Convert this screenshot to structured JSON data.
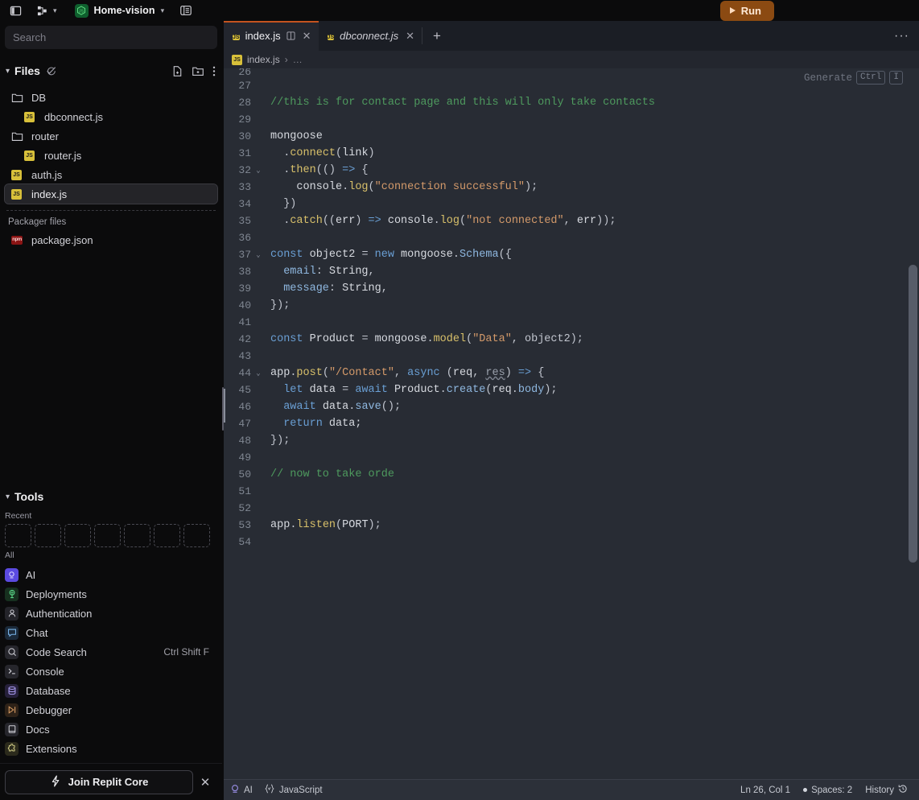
{
  "topbar": {
    "panel_toggle_icon": "sidebar-toggle-icon",
    "layout_icon": "layout-grid-icon",
    "project_name": "Home-vision",
    "project_icon": "nodejs-icon",
    "list_icon": "database-list-icon",
    "run_label": "Run",
    "run_color": "#8b4a12"
  },
  "sidebar": {
    "search": {
      "placeholder": "Search",
      "value": ""
    },
    "files": {
      "title": "Files",
      "caret": "⌄",
      "new_file_icon": "new-file-icon",
      "new_folder_icon": "new-folder-icon",
      "more_icon": "kebab-menu-icon",
      "tree": [
        {
          "label": "DB",
          "type": "folder",
          "indent": 0,
          "selected": false
        },
        {
          "label": "dbconnect.js",
          "type": "js",
          "indent": 1,
          "selected": false
        },
        {
          "label": "router",
          "type": "folder",
          "indent": 0,
          "selected": false
        },
        {
          "label": "router.js",
          "type": "js",
          "indent": 1,
          "selected": false
        },
        {
          "label": "auth.js",
          "type": "js",
          "indent": 0,
          "selected": false
        },
        {
          "label": "index.js",
          "type": "js",
          "indent": 0,
          "selected": true
        }
      ],
      "packager_label": "Packager files",
      "packager_files": [
        {
          "label": "package.json",
          "type": "json"
        }
      ]
    },
    "tools": {
      "title": "Tools",
      "recent_label": "Recent",
      "recent_slots": 7,
      "all_label": "All",
      "items": [
        {
          "label": "AI",
          "icon": "ai-icon",
          "color": "#5b4ae0",
          "shortcut": ""
        },
        {
          "label": "Deployments",
          "icon": "deployments-icon",
          "color": "#17301f",
          "shortcut": ""
        },
        {
          "label": "Authentication",
          "icon": "authentication-icon",
          "color": "#24242a",
          "shortcut": ""
        },
        {
          "label": "Chat",
          "icon": "chat-icon",
          "color": "#1b2a3a",
          "shortcut": ""
        },
        {
          "label": "Code Search",
          "icon": "code-search-icon",
          "color": "#26262c",
          "shortcut": "Ctrl Shift F"
        },
        {
          "label": "Console",
          "icon": "console-icon",
          "color": "#26262c",
          "shortcut": ""
        },
        {
          "label": "Database",
          "icon": "database-icon",
          "color": "#26203a",
          "shortcut": ""
        },
        {
          "label": "Debugger",
          "icon": "debugger-icon",
          "color": "#2e2218",
          "shortcut": ""
        },
        {
          "label": "Docs",
          "icon": "docs-icon",
          "color": "#26262c",
          "shortcut": ""
        },
        {
          "label": "Extensions",
          "icon": "extensions-icon",
          "color": "#2b2a1c",
          "shortcut": ""
        }
      ]
    },
    "core_banner": {
      "label": "Join Replit Core",
      "icon": "bolt-icon",
      "close_icon": "close-icon"
    }
  },
  "editor": {
    "tabs": [
      {
        "label": "index.js",
        "icon": "js-file-icon",
        "active": true,
        "preview": false,
        "split_icon": "split-editor-icon",
        "close_icon": "close-icon"
      },
      {
        "label": "dbconnect.js",
        "icon": "js-file-icon",
        "active": false,
        "preview": true,
        "close_icon": "close-icon"
      }
    ],
    "add_tab_label": "+",
    "more_label": "···",
    "breadcrumb": {
      "file": "index.js",
      "separator": "›",
      "tail": "…"
    },
    "ghost_generate": {
      "label": "Generate",
      "key1": "Ctrl",
      "key2": "I"
    },
    "lines": [
      {
        "n": 26,
        "fold": "",
        "partial": true,
        "tokens": []
      },
      {
        "n": 27,
        "fold": "",
        "tokens": []
      },
      {
        "n": 28,
        "fold": "",
        "tokens": [
          {
            "t": "//this is for contact page and this will only take contacts",
            "c": "cm"
          }
        ]
      },
      {
        "n": 29,
        "fold": "",
        "tokens": []
      },
      {
        "n": 30,
        "fold": "",
        "tokens": [
          {
            "t": "mongoose",
            "c": "vr"
          }
        ]
      },
      {
        "n": 31,
        "fold": "",
        "tokens": [
          {
            "t": "  .",
            "c": "pu"
          },
          {
            "t": "connect",
            "c": "fn"
          },
          {
            "t": "(",
            "c": "pu"
          },
          {
            "t": "link",
            "c": "vr"
          },
          {
            "t": ")",
            "c": "pu"
          }
        ]
      },
      {
        "n": 32,
        "fold": "⌄",
        "tokens": [
          {
            "t": "  .",
            "c": "pu"
          },
          {
            "t": "then",
            "c": "fn"
          },
          {
            "t": "(() ",
            "c": "pu"
          },
          {
            "t": "=>",
            "c": "k"
          },
          {
            "t": " {",
            "c": "pu"
          }
        ]
      },
      {
        "n": 33,
        "fold": "",
        "tokens": [
          {
            "t": "    ",
            "c": "pu"
          },
          {
            "t": "console",
            "c": "vr"
          },
          {
            "t": ".",
            "c": "pu"
          },
          {
            "t": "log",
            "c": "fn"
          },
          {
            "t": "(",
            "c": "pu"
          },
          {
            "t": "\"connection successful\"",
            "c": "st"
          },
          {
            "t": ");",
            "c": "pu"
          }
        ]
      },
      {
        "n": 34,
        "fold": "",
        "tokens": [
          {
            "t": "  })",
            "c": "pu"
          }
        ]
      },
      {
        "n": 35,
        "fold": "",
        "tokens": [
          {
            "t": "  .",
            "c": "pu"
          },
          {
            "t": "catch",
            "c": "fn"
          },
          {
            "t": "((",
            "c": "pu"
          },
          {
            "t": "err",
            "c": "vr"
          },
          {
            "t": ") ",
            "c": "pu"
          },
          {
            "t": "=>",
            "c": "k"
          },
          {
            "t": " ",
            "c": "pu"
          },
          {
            "t": "console",
            "c": "vr"
          },
          {
            "t": ".",
            "c": "pu"
          },
          {
            "t": "log",
            "c": "fn"
          },
          {
            "t": "(",
            "c": "pu"
          },
          {
            "t": "\"not connected\"",
            "c": "st"
          },
          {
            "t": ", ",
            "c": "pu"
          },
          {
            "t": "err",
            "c": "vr"
          },
          {
            "t": "));",
            "c": "pu"
          }
        ]
      },
      {
        "n": 36,
        "fold": "",
        "tokens": []
      },
      {
        "n": 37,
        "fold": "⌄",
        "tokens": [
          {
            "t": "const",
            "c": "k"
          },
          {
            "t": " object2 ",
            "c": "vr"
          },
          {
            "t": "= ",
            "c": "pu"
          },
          {
            "t": "new",
            "c": "k"
          },
          {
            "t": " mongoose",
            "c": "vr"
          },
          {
            "t": ".",
            "c": "pu"
          },
          {
            "t": "Schema",
            "c": "pr"
          },
          {
            "t": "({",
            "c": "pu"
          }
        ]
      },
      {
        "n": 38,
        "fold": "",
        "tokens": [
          {
            "t": "  ",
            "c": "pu"
          },
          {
            "t": "email",
            "c": "pr"
          },
          {
            "t": ": ",
            "c": "pu"
          },
          {
            "t": "String",
            "c": "vr"
          },
          {
            "t": ",",
            "c": "pu"
          }
        ]
      },
      {
        "n": 39,
        "fold": "",
        "tokens": [
          {
            "t": "  ",
            "c": "pu"
          },
          {
            "t": "message",
            "c": "pr"
          },
          {
            "t": ": ",
            "c": "pu"
          },
          {
            "t": "String",
            "c": "vr"
          },
          {
            "t": ",",
            "c": "pu"
          }
        ]
      },
      {
        "n": 40,
        "fold": "",
        "tokens": [
          {
            "t": "});",
            "c": "pu"
          }
        ]
      },
      {
        "n": 41,
        "fold": "",
        "tokens": []
      },
      {
        "n": 42,
        "fold": "",
        "tokens": [
          {
            "t": "const",
            "c": "k"
          },
          {
            "t": " Product ",
            "c": "vr"
          },
          {
            "t": "= ",
            "c": "pu"
          },
          {
            "t": "mongoose",
            "c": "vr"
          },
          {
            "t": ".",
            "c": "pu"
          },
          {
            "t": "model",
            "c": "fn"
          },
          {
            "t": "(",
            "c": "pu"
          },
          {
            "t": "\"Data\"",
            "c": "st"
          },
          {
            "t": ", object2);",
            "c": "pu"
          }
        ]
      },
      {
        "n": 43,
        "fold": "",
        "tokens": []
      },
      {
        "n": 44,
        "fold": "⌄",
        "tokens": [
          {
            "t": "app",
            "c": "vr"
          },
          {
            "t": ".",
            "c": "pu"
          },
          {
            "t": "post",
            "c": "fn"
          },
          {
            "t": "(",
            "c": "pu"
          },
          {
            "t": "\"/Contact\"",
            "c": "st"
          },
          {
            "t": ", ",
            "c": "pu"
          },
          {
            "t": "async",
            "c": "k"
          },
          {
            "t": " (",
            "c": "pu"
          },
          {
            "t": "req",
            "c": "vr"
          },
          {
            "t": ", ",
            "c": "pu"
          },
          {
            "t": "res",
            "c": "un"
          },
          {
            "t": ") ",
            "c": "pu"
          },
          {
            "t": "=>",
            "c": "k"
          },
          {
            "t": " {",
            "c": "pu"
          }
        ]
      },
      {
        "n": 45,
        "fold": "",
        "tokens": [
          {
            "t": "  ",
            "c": "pu"
          },
          {
            "t": "let",
            "c": "k"
          },
          {
            "t": " data ",
            "c": "vr"
          },
          {
            "t": "= ",
            "c": "pu"
          },
          {
            "t": "await",
            "c": "k"
          },
          {
            "t": " Product",
            "c": "vr"
          },
          {
            "t": ".",
            "c": "pu"
          },
          {
            "t": "create",
            "c": "pr"
          },
          {
            "t": "(",
            "c": "pu"
          },
          {
            "t": "req",
            "c": "vr"
          },
          {
            "t": ".",
            "c": "pu"
          },
          {
            "t": "body",
            "c": "pr"
          },
          {
            "t": ");",
            "c": "pu"
          }
        ]
      },
      {
        "n": 46,
        "fold": "",
        "tokens": [
          {
            "t": "  ",
            "c": "pu"
          },
          {
            "t": "await",
            "c": "k"
          },
          {
            "t": " data",
            "c": "vr"
          },
          {
            "t": ".",
            "c": "pu"
          },
          {
            "t": "save",
            "c": "pr"
          },
          {
            "t": "();",
            "c": "pu"
          }
        ]
      },
      {
        "n": 47,
        "fold": "",
        "tokens": [
          {
            "t": "  ",
            "c": "pu"
          },
          {
            "t": "return",
            "c": "k"
          },
          {
            "t": " data;",
            "c": "vr"
          }
        ]
      },
      {
        "n": 48,
        "fold": "",
        "tokens": [
          {
            "t": "});",
            "c": "pu"
          }
        ]
      },
      {
        "n": 49,
        "fold": "",
        "tokens": []
      },
      {
        "n": 50,
        "fold": "",
        "tokens": [
          {
            "t": "// now to take orde",
            "c": "cm"
          }
        ]
      },
      {
        "n": 51,
        "fold": "",
        "tokens": []
      },
      {
        "n": 52,
        "fold": "",
        "tokens": []
      },
      {
        "n": 53,
        "fold": "",
        "tokens": [
          {
            "t": "app",
            "c": "vr"
          },
          {
            "t": ".",
            "c": "pu"
          },
          {
            "t": "listen",
            "c": "fn"
          },
          {
            "t": "(",
            "c": "pu"
          },
          {
            "t": "PORT",
            "c": "vr"
          },
          {
            "t": ");",
            "c": "pu"
          }
        ]
      },
      {
        "n": 54,
        "fold": "",
        "tokens": []
      }
    ],
    "statusbar": {
      "ai_label": "AI",
      "ai_icon": "ai-icon",
      "language_label": "JavaScript",
      "language_icon": "braces-icon",
      "cursor_position": "Ln 26, Col 1",
      "indent_label": "Spaces: 2",
      "history_label": "History",
      "history_icon": "history-icon"
    }
  }
}
